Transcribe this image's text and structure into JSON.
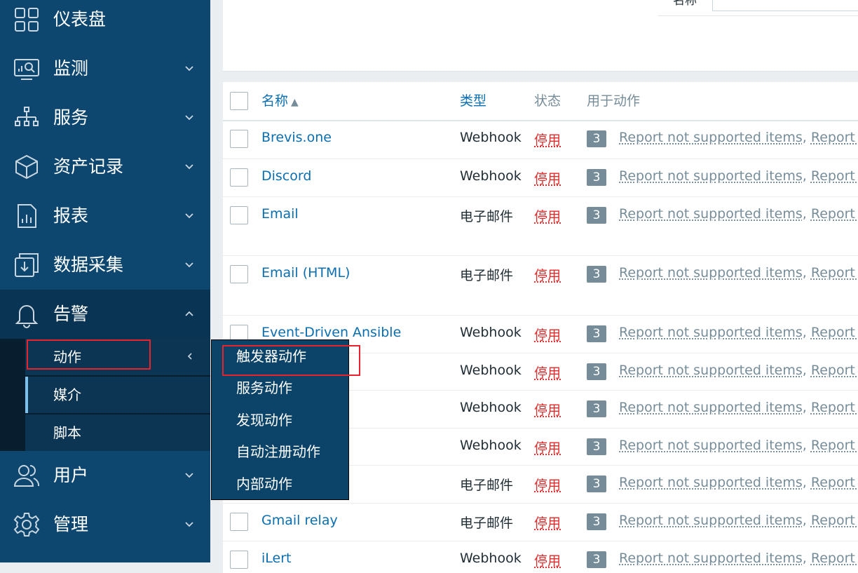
{
  "sidebar": {
    "items": [
      {
        "label": "仪表盘",
        "icon": "dashboard-icon"
      },
      {
        "label": "监测",
        "icon": "monitoring-icon"
      },
      {
        "label": "服务",
        "icon": "services-icon"
      },
      {
        "label": "资产记录",
        "icon": "inventory-icon"
      },
      {
        "label": "报表",
        "icon": "reports-icon"
      },
      {
        "label": "数据采集",
        "icon": "data-collection-icon"
      },
      {
        "label": "告警",
        "icon": "bell-icon"
      },
      {
        "label": "用户",
        "icon": "users-icon"
      },
      {
        "label": "管理",
        "icon": "gear-icon"
      }
    ],
    "alerts_submenu": [
      {
        "label": "动作"
      },
      {
        "label": "媒介"
      },
      {
        "label": "脚本"
      }
    ]
  },
  "flyout": {
    "items": [
      "触发器动作",
      "服务动作",
      "发现动作",
      "自动注册动作",
      "内部动作"
    ]
  },
  "filter": {
    "label": "名称"
  },
  "table": {
    "headers": {
      "name": "名称",
      "sort_indicator": "▲",
      "type": "类型",
      "status": "状态",
      "used_in_actions": "用于动作"
    },
    "rows": [
      {
        "name": "Brevis.one",
        "type": "Webhook",
        "status": "停用",
        "count": "3",
        "action1": "Report not supported items",
        "sep": ", ",
        "action2": "Report n"
      },
      {
        "name": "Discord",
        "type": "Webhook",
        "status": "停用",
        "count": "3",
        "action1": "Report not supported items",
        "sep": ", ",
        "action2": "Report n"
      },
      {
        "name": "Email",
        "type": "电子邮件",
        "status": "停用",
        "count": "3",
        "action1": "Report not supported items",
        "sep": ", ",
        "action2": "Report n"
      },
      {
        "name": "Email (HTML)",
        "type": "电子邮件",
        "status": "停用",
        "count": "3",
        "action1": "Report not supported items",
        "sep": ", ",
        "action2": "Report n"
      },
      {
        "name": "Event-Driven Ansible",
        "type": "Webhook",
        "status": "停用",
        "count": "3",
        "action1": "Report not supported items",
        "sep": ", ",
        "action2": "Report n"
      },
      {
        "name": "",
        "type": "Webhook",
        "status": "停用",
        "count": "3",
        "action1": "Report not supported items",
        "sep": ", ",
        "action2": "Report n"
      },
      {
        "name": "",
        "type": "Webhook",
        "status": "停用",
        "count": "3",
        "action1": "Report not supported items",
        "sep": ", ",
        "action2": "Report n"
      },
      {
        "name": "",
        "type": "Webhook",
        "status": "停用",
        "count": "3",
        "action1": "Report not supported items",
        "sep": ", ",
        "action2": "Report n"
      },
      {
        "name": "",
        "type": "电子邮件",
        "status": "停用",
        "count": "3",
        "action1": "Report not supported items",
        "sep": ", ",
        "action2": "Report n"
      },
      {
        "name": "Gmail relay",
        "type": "电子邮件",
        "status": "停用",
        "count": "3",
        "action1": "Report not supported items",
        "sep": ", ",
        "action2": "Report n"
      },
      {
        "name": "iLert",
        "type": "Webhook",
        "status": "停用",
        "count": "3",
        "action1": "Report not supported items",
        "sep": ", ",
        "action2": "Report n"
      }
    ]
  },
  "colors": {
    "sidebar": "#0d4770",
    "link": "#0a6eb0",
    "disabled": "#e22b2b",
    "highlight": "#e8232c"
  }
}
